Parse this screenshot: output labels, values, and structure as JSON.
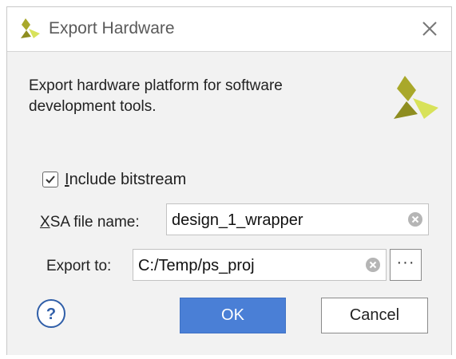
{
  "window": {
    "title": "Export Hardware",
    "title_icon": "xilinx-logo-icon",
    "close_icon": "close-icon"
  },
  "description": "Export hardware platform for software development tools.",
  "brand_icon": "xilinx-logo-icon",
  "include_bitstream": {
    "label_mnemonic": "I",
    "label_rest": "nclude bitstream",
    "checked": true
  },
  "xsa": {
    "label_mnemonic": "X",
    "label_rest": "SA file name:",
    "value": "design_1_wrapper"
  },
  "export_to": {
    "label": "Export to:",
    "value": "C:/Temp/ps_proj",
    "browse_label": "···"
  },
  "buttons": {
    "help": "?",
    "ok": "OK",
    "cancel": "Cancel"
  },
  "colors": {
    "ok_button": "#4a7fd6",
    "logo_dark": "#a9a82a",
    "logo_light": "#d8e25a"
  }
}
